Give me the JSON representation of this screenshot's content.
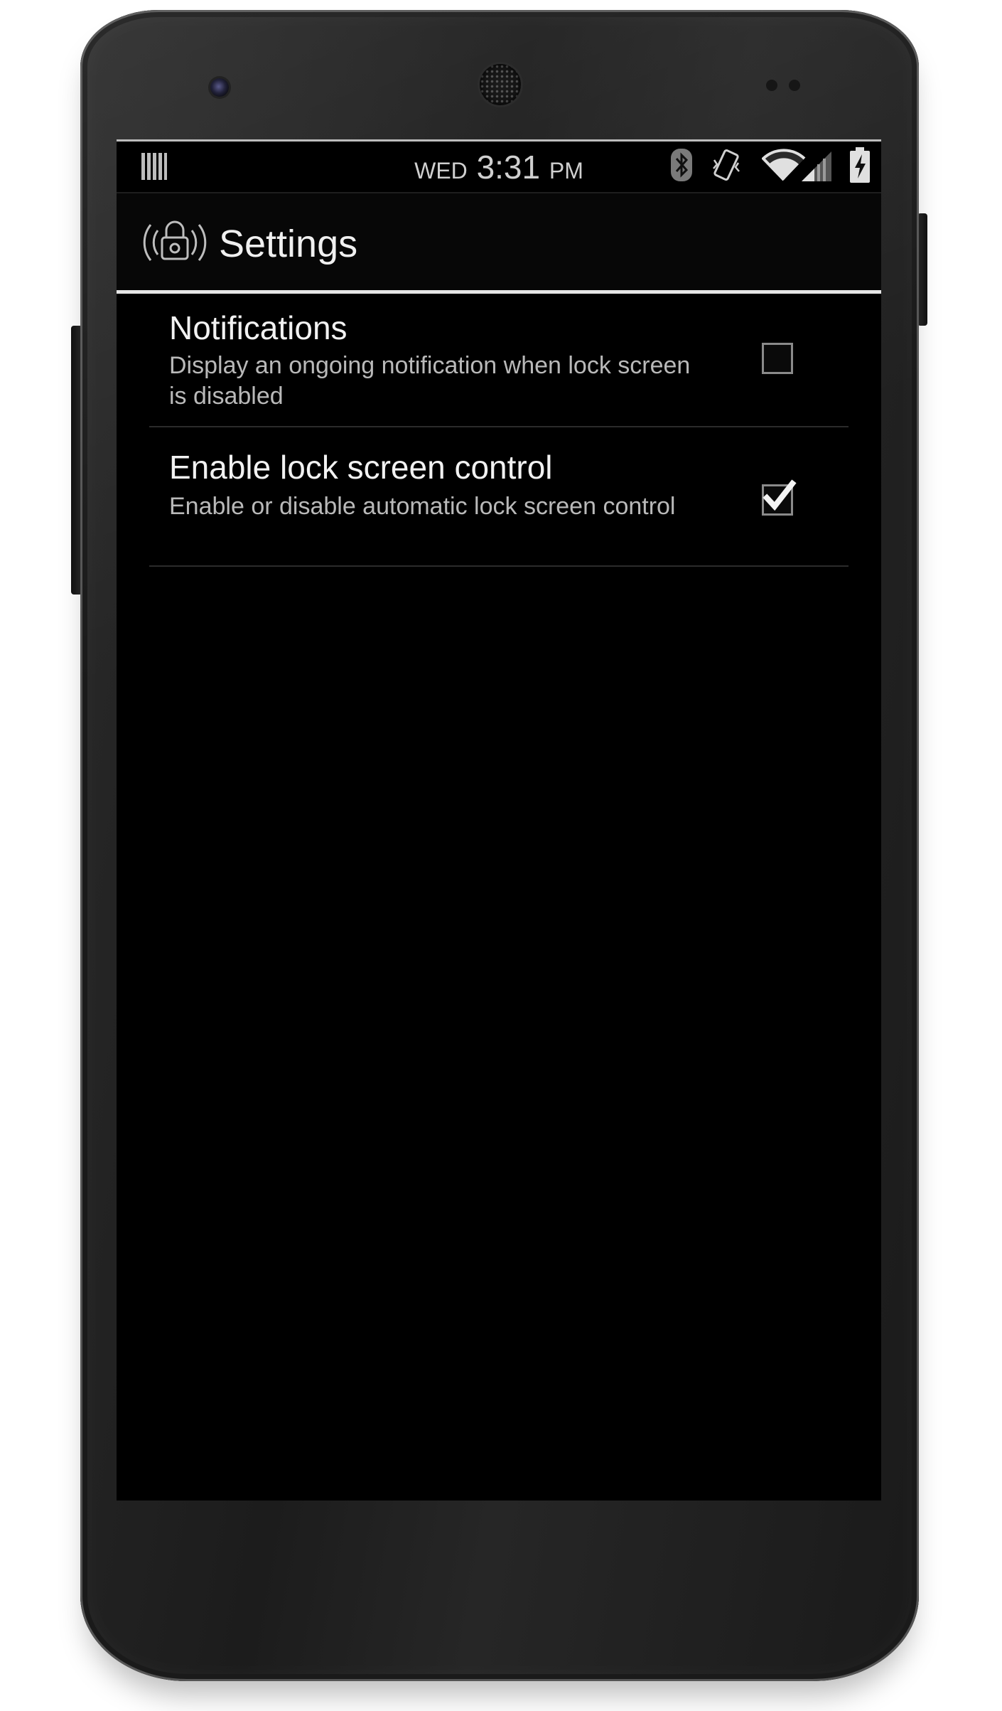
{
  "status_bar": {
    "day": "WED",
    "time": "3:31",
    "ampm": "PM",
    "icons": [
      "notification-bars-icon",
      "bluetooth-icon",
      "vibrate-icon",
      "wifi-icon",
      "signal-icon",
      "battery-charging-icon"
    ]
  },
  "action_bar": {
    "title": "Settings",
    "app_icon": "lock-signal-icon"
  },
  "preferences": [
    {
      "title": "Notifications",
      "summary": "Display an ongoing notification when lock screen is disabled",
      "checked": false
    },
    {
      "title": "Enable lock screen control",
      "summary": "Enable or disable automatic lock screen control",
      "checked": true
    }
  ],
  "colors": {
    "background": "#000000",
    "title_text": "#f2f2f2",
    "summary_text": "#b9b9b9",
    "divider": "#2b2b2b",
    "actionbar_underline": "#e6e6e6"
  }
}
